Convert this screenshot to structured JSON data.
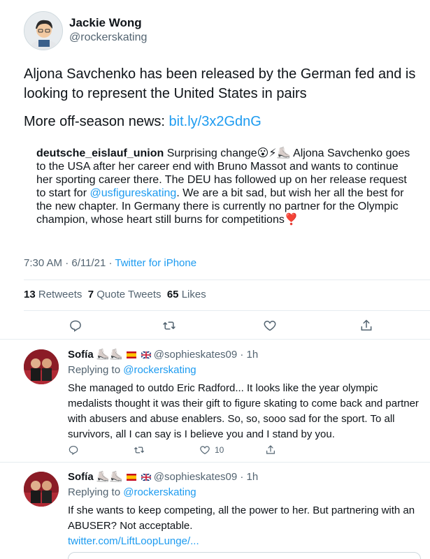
{
  "main_tweet": {
    "author_name": "Jackie Wong",
    "author_handle": "@rockerskating",
    "text_line": "Aljona Savchenko has been released by the German fed and is looking to represent the United States in pairs",
    "more_prefix": "More off-season news: ",
    "more_link": "bit.ly/3x2GdnG",
    "quote": {
      "account": "deutsche_eislauf_union",
      "text_before_mention": " Surprising change😮⚡⛸️ Aljona Savchenko goes to the USA after her career end with Bruno Massot and wants to continue her sporting career there. The DEU has followed up on her release request to start for ",
      "mention": "@usfigureskating",
      "text_after_mention": ". We are a bit sad, but wish her all the best for the new chapter. In Germany there is currently no partner for the Olympic champion, whose heart still burns for competitions❣️"
    },
    "meta": {
      "time_date": "7:30 AM · 6/11/21 · ",
      "source": "Twitter for iPhone"
    },
    "stats": {
      "retweets_count": "13",
      "retweets_label": " Retweets  ",
      "quote_count": "7",
      "quote_label": " Quote Tweets  ",
      "likes_count": "65",
      "likes_label": " Likes"
    }
  },
  "replies": [
    {
      "name": "Sofía",
      "handle_time": "@sophieskates09 · 1h",
      "replying_label": "Replying to ",
      "replying_to": "@rockerskating",
      "text": "She managed to outdo Eric Radford... It looks like the year olympic medalists thought it was their gift to figure skating to come back and partner with abusers and abuse enablers. So, so, sooo sad for the sport. To all survivors, all I can say is I believe you and I stand by you.",
      "like_count": "10"
    },
    {
      "name": "Sofía",
      "handle_time": "@sophieskates09 · 1h",
      "replying_label": "Replying to ",
      "replying_to": "@rockerskating",
      "text": "If she wants to keep competing, all the power to her. But partnering with an ABUSER? Not acceptable.",
      "link": "twitter.com/LiftLoopLunge/..."
    }
  ],
  "colors": {
    "accent": "#1d9bf0",
    "secondary_text": "#536471",
    "divider": "#e6ecf0",
    "heart_emoji": "#e0245e"
  },
  "icons": [
    "reply-icon",
    "retweet-icon",
    "like-icon",
    "share-icon",
    "skate-icon",
    "spain-flag-icon",
    "uk-flag-icon"
  ]
}
